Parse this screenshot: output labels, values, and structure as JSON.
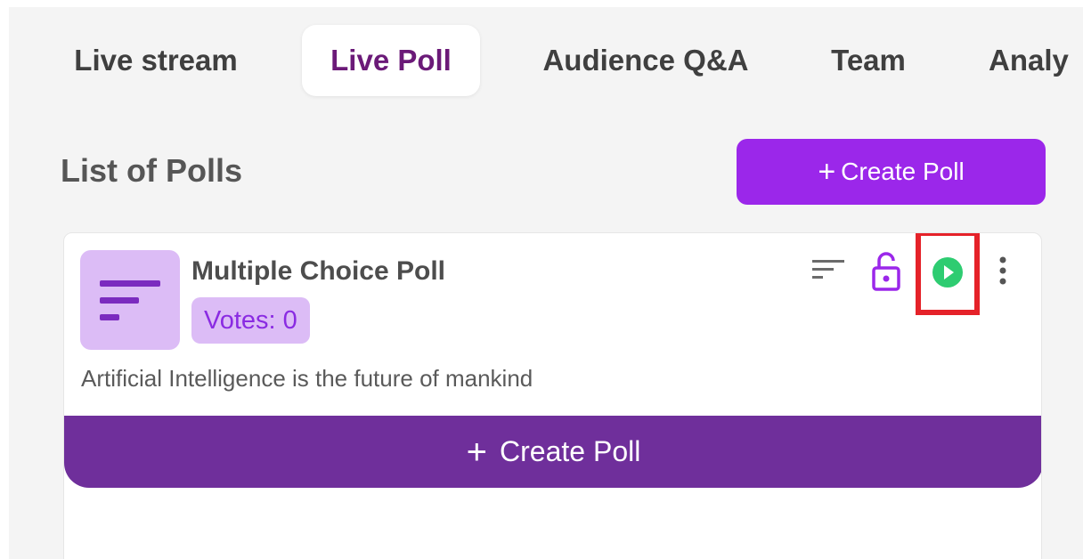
{
  "tabs": [
    {
      "label": "Live stream",
      "active": false
    },
    {
      "label": "Live Poll",
      "active": true
    },
    {
      "label": "Audience Q&A",
      "active": false
    },
    {
      "label": "Team",
      "active": false
    },
    {
      "label": "Analy",
      "active": false
    }
  ],
  "section": {
    "title": "List of Polls",
    "create_button": {
      "icon": "plus-icon",
      "label": "Create Poll"
    }
  },
  "poll": {
    "type_icon": "lines-icon",
    "title": "Multiple Choice Poll",
    "votes": "Votes: 0",
    "description": "Artificial Intelligence is the future of mankind",
    "actions": [
      "sort-icon",
      "unlock-icon",
      "play-icon",
      "more-vertical-icon"
    ],
    "highlighted_action": "play-icon"
  },
  "footer_button": {
    "icon": "plus-icon",
    "label": "Create Poll"
  },
  "colors": {
    "active_tab_text": "#6b1a78",
    "primary_button": "#9b27ea",
    "footer_button": "#6f2f9b",
    "badge_bg": "#dcbcf6",
    "badge_text": "#8a2be2",
    "play_icon": "#2ecc71",
    "lock_icon": "#9b27ea",
    "highlight": "#e52229"
  }
}
